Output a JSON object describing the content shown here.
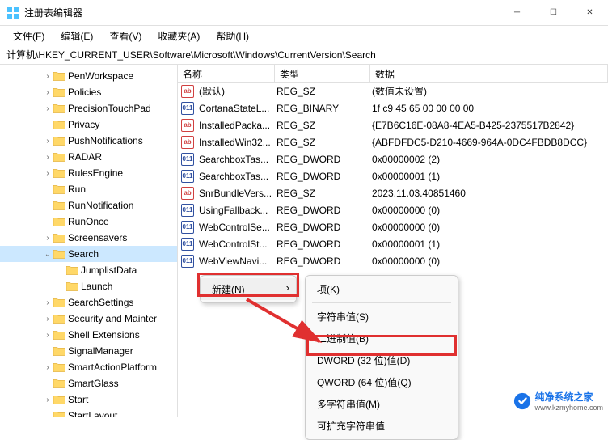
{
  "window": {
    "title": "注册表编辑器"
  },
  "menubar": {
    "file": "文件(F)",
    "edit": "编辑(E)",
    "view": "查看(V)",
    "favorites": "收藏夹(A)",
    "help": "帮助(H)"
  },
  "address": "计算机\\HKEY_CURRENT_USER\\Software\\Microsoft\\Windows\\CurrentVersion\\Search",
  "tree": [
    {
      "label": "PenWorkspace",
      "indent": 52,
      "exp": "›"
    },
    {
      "label": "Policies",
      "indent": 52,
      "exp": "›"
    },
    {
      "label": "PrecisionTouchPad",
      "indent": 52,
      "exp": "›"
    },
    {
      "label": "Privacy",
      "indent": 52,
      "exp": ""
    },
    {
      "label": "PushNotifications",
      "indent": 52,
      "exp": "›"
    },
    {
      "label": "RADAR",
      "indent": 52,
      "exp": "›"
    },
    {
      "label": "RulesEngine",
      "indent": 52,
      "exp": "›"
    },
    {
      "label": "Run",
      "indent": 52,
      "exp": ""
    },
    {
      "label": "RunNotification",
      "indent": 52,
      "exp": ""
    },
    {
      "label": "RunOnce",
      "indent": 52,
      "exp": ""
    },
    {
      "label": "Screensavers",
      "indent": 52,
      "exp": "›"
    },
    {
      "label": "Search",
      "indent": 52,
      "exp": "⌄",
      "selected": true
    },
    {
      "label": "JumplistData",
      "indent": 68,
      "exp": ""
    },
    {
      "label": "Launch",
      "indent": 68,
      "exp": ""
    },
    {
      "label": "SearchSettings",
      "indent": 52,
      "exp": "›"
    },
    {
      "label": "Security and Mainter",
      "indent": 52,
      "exp": "›"
    },
    {
      "label": "Shell Extensions",
      "indent": 52,
      "exp": "›"
    },
    {
      "label": "SignalManager",
      "indent": 52,
      "exp": ""
    },
    {
      "label": "SmartActionPlatform",
      "indent": 52,
      "exp": "›"
    },
    {
      "label": "SmartGlass",
      "indent": 52,
      "exp": ""
    },
    {
      "label": "Start",
      "indent": 52,
      "exp": "›"
    },
    {
      "label": "StartLayout",
      "indent": 52,
      "exp": ""
    }
  ],
  "list": {
    "headers": {
      "name": "名称",
      "type": "类型",
      "data": "数据"
    },
    "rows": [
      {
        "icon": "sz",
        "name": "(默认)",
        "type": "REG_SZ",
        "data": "(数值未设置)"
      },
      {
        "icon": "bin",
        "name": "CortanaStateL...",
        "type": "REG_BINARY",
        "data": "1f c9 45 65 00 00 00 00"
      },
      {
        "icon": "sz",
        "name": "InstalledPacka...",
        "type": "REG_SZ",
        "data": "{E7B6C16E-08A8-4EA5-B425-2375517B2842}"
      },
      {
        "icon": "sz",
        "name": "InstalledWin32...",
        "type": "REG_SZ",
        "data": "{ABFDFDC5-D210-4669-964A-0DC4FBDB8DCC}"
      },
      {
        "icon": "bin",
        "name": "SearchboxTas...",
        "type": "REG_DWORD",
        "data": "0x00000002 (2)"
      },
      {
        "icon": "bin",
        "name": "SearchboxTas...",
        "type": "REG_DWORD",
        "data": "0x00000001 (1)"
      },
      {
        "icon": "sz",
        "name": "SnrBundleVers...",
        "type": "REG_SZ",
        "data": "2023.11.03.40851460"
      },
      {
        "icon": "bin",
        "name": "UsingFallback...",
        "type": "REG_DWORD",
        "data": "0x00000000 (0)"
      },
      {
        "icon": "bin",
        "name": "WebControlSe...",
        "type": "REG_DWORD",
        "data": "0x00000000 (0)"
      },
      {
        "icon": "bin",
        "name": "WebControlSt...",
        "type": "REG_DWORD",
        "data": "0x00000001 (1)"
      },
      {
        "icon": "bin",
        "name": "WebViewNavi...",
        "type": "REG_DWORD",
        "data": "0x00000000 (0)"
      }
    ]
  },
  "context": {
    "parent": {
      "new": "新建(N)"
    },
    "sub": {
      "key": "项(K)",
      "string": "字符串值(S)",
      "binary": "二进制值(B)",
      "dword": "DWORD (32 位)值(D)",
      "qword": "QWORD (64 位)值(Q)",
      "multi": "多字符串值(M)",
      "expand": "可扩充字符串值"
    }
  },
  "watermark": {
    "text1": "纯净系统之家",
    "text2": "www.kzmyhome.com"
  }
}
